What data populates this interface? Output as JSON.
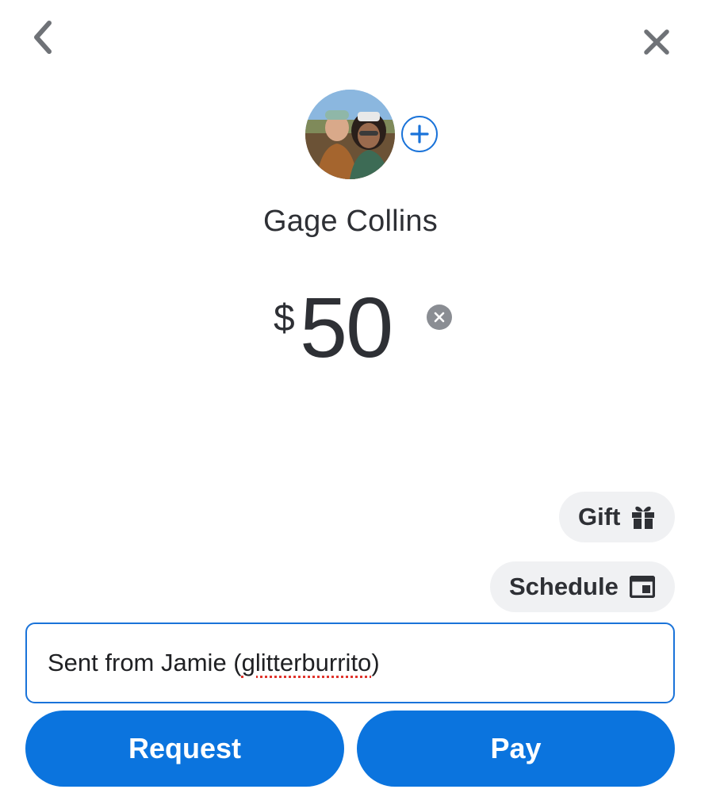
{
  "header": {
    "back_icon": "chevron-left-icon",
    "close_icon": "close-icon"
  },
  "recipient": {
    "name": "Gage Collins",
    "add_icon": "plus-icon"
  },
  "amount": {
    "currency_symbol": "$",
    "value": "50",
    "clear_icon": "clear-circle-icon"
  },
  "options": {
    "gift_label": "Gift",
    "gift_icon": "gift-icon",
    "schedule_label": "Schedule",
    "schedule_icon": "calendar-icon"
  },
  "note": {
    "prefix": "Sent from Jamie (",
    "misspelled": "glitterburrito",
    "suffix": ")"
  },
  "actions": {
    "request_label": "Request",
    "pay_label": "Pay"
  },
  "colors": {
    "accent": "#0b74de",
    "text": "#2e3035",
    "pill_bg": "#f0f1f3",
    "spellcheck": "#e0342c"
  }
}
